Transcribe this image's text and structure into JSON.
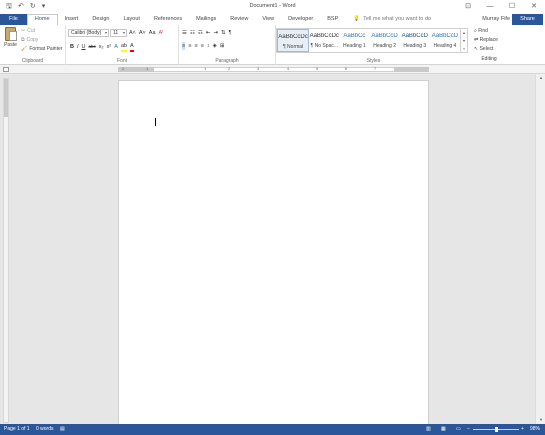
{
  "window": {
    "title": "Document1 - Word",
    "controls": {
      "restore_ribbon": "⊡",
      "minimize": "—",
      "maximize": "☐",
      "close": "✕"
    }
  },
  "qat": {
    "save": "🖫",
    "undo": "↶",
    "redo": "↻",
    "customize": "▾"
  },
  "tabs": {
    "file": "File",
    "home": "Home",
    "insert": "Insert",
    "design": "Design",
    "layout": "Layout",
    "references": "References",
    "mailings": "Mailings",
    "review": "Review",
    "view": "View",
    "developer": "Developer",
    "bsp": "BSP"
  },
  "tell_me": {
    "placeholder": "Tell me what you want to do",
    "icon": "lightbulb-icon"
  },
  "account": {
    "user": "Murray Fife",
    "share": "Share"
  },
  "clipboard": {
    "paste": "Paste",
    "cut": "Cut",
    "copy": "Copy",
    "format_painter": "Format Painter",
    "label": "Clipboard"
  },
  "font": {
    "name": "Calibri (Body)",
    "size": "11",
    "grow": "A˄",
    "shrink": "A˅",
    "case": "Aa",
    "clear": "A̸",
    "bold": "B",
    "italic": "I",
    "underline": "U",
    "strike": "abc",
    "subscript": "x₂",
    "superscript": "x²",
    "effects": "A",
    "highlight": "ab",
    "color": "A",
    "label": "Font"
  },
  "paragraph": {
    "bullets": "☰",
    "numbering": "☷",
    "multilevel": "☶",
    "decrease_indent": "⇤",
    "increase_indent": "⇥",
    "sort": "⇅",
    "show_marks": "¶",
    "align_left": "≡",
    "center": "≡",
    "align_right": "≡",
    "justify": "≡",
    "line_spacing": "↕",
    "shading": "◈",
    "borders": "⊞",
    "label": "Paragraph"
  },
  "styles": {
    "items": [
      {
        "sample": "AaBbCcDc",
        "name": "¶ Normal",
        "color": "#333333"
      },
      {
        "sample": "AaBbCcDc",
        "name": "¶ No Spac...",
        "color": "#333333"
      },
      {
        "sample": "AaBbCc",
        "name": "Heading 1",
        "color": "#2e74b5"
      },
      {
        "sample": "AaBbCcD",
        "name": "Heading 2",
        "color": "#2e74b5"
      },
      {
        "sample": "AaBbCcD",
        "name": "Heading 3",
        "color": "#1f4e79"
      },
      {
        "sample": "AaBbCcD",
        "name": "Heading 4",
        "color": "#2e74b5"
      }
    ],
    "label": "Styles"
  },
  "editing": {
    "find": "Find",
    "replace": "Replace",
    "select": "Select",
    "label": "Editing"
  },
  "ruler": {
    "numbers": [
      "2",
      "1",
      "1",
      "2",
      "3",
      "4",
      "5",
      "6",
      "7"
    ]
  },
  "status": {
    "page": "Page 1 of 1",
    "words": "0 words",
    "zoom": "98%",
    "zoom_fraction": 0.49
  },
  "colors": {
    "accent": "#2b579a",
    "highlight": "#ffff00",
    "font_color": "#ff0000"
  }
}
